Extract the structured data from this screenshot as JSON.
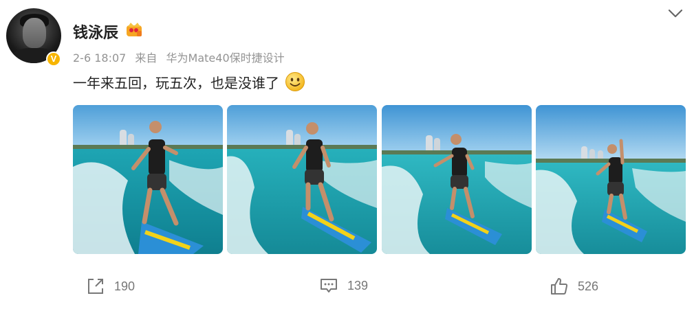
{
  "post": {
    "author": "钱泳辰",
    "time": "2-6 18:07",
    "source_prefix": "来自",
    "source": "华为Mate40保时捷设计",
    "text": "一年来五回，玩五次，也是没谁了",
    "verified_mark": "V",
    "icons": {
      "avatar": "avatar-image",
      "vip": "vip-crown-icon",
      "menu": "chevron-down-icon",
      "emoji": "smile-emoji-icon"
    }
  },
  "photos": [
    {
      "name": "photo-1"
    },
    {
      "name": "photo-2"
    },
    {
      "name": "photo-3"
    },
    {
      "name": "photo-4"
    }
  ],
  "actions": {
    "repost": {
      "icon": "share-icon",
      "count": "190"
    },
    "comment": {
      "icon": "comment-icon",
      "count": "139"
    },
    "like": {
      "icon": "thumbs-up-icon",
      "count": "526"
    }
  },
  "colors": {
    "sky": "#6fb6e6",
    "sea": "#2fb8c2",
    "board": "#2b8fd6",
    "verified": "#f7b500"
  }
}
